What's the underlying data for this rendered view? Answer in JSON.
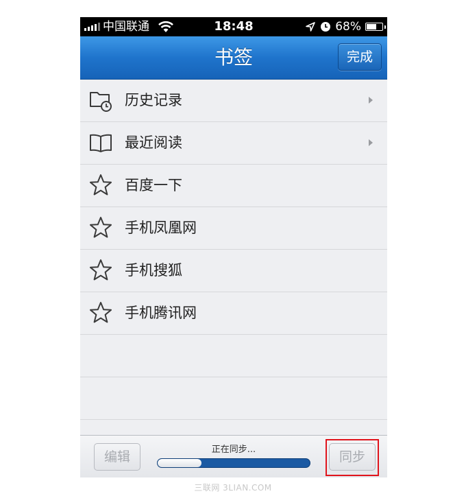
{
  "status_bar": {
    "carrier": "中国联通",
    "time": "18:48",
    "battery_text": "68%",
    "battery_level": 0.68,
    "signal_bars": 4
  },
  "nav": {
    "title": "书签",
    "done_label": "完成"
  },
  "items": [
    {
      "label": "历史记录",
      "icon": "history-folder-icon",
      "chevron": true
    },
    {
      "label": "最近阅读",
      "icon": "book-icon",
      "chevron": true
    },
    {
      "label": "百度一下",
      "icon": "star-icon",
      "chevron": false
    },
    {
      "label": "手机凤凰网",
      "icon": "star-icon",
      "chevron": false
    },
    {
      "label": "手机搜狐",
      "icon": "star-icon",
      "chevron": false
    },
    {
      "label": "手机腾讯网",
      "icon": "star-icon",
      "chevron": false
    }
  ],
  "toolbar": {
    "edit_label": "编辑",
    "sync_label": "同步",
    "sync_status": "正在同步...",
    "sync_progress": 0.29
  },
  "watermark": "三联网 3LIAN.COM",
  "colors": {
    "nav_blue": "#1f74cc",
    "highlight_red": "#e0141c",
    "progress_blue": "#1b5aa3"
  }
}
